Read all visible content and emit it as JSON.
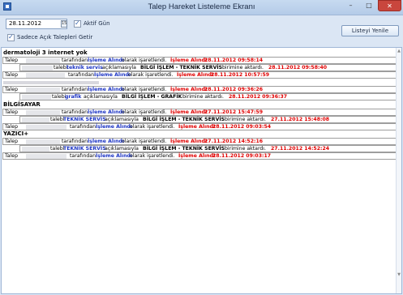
{
  "window": {
    "title": "Talep Hareket Listeleme Ekranı",
    "controls": {
      "minimize": "–",
      "maximize": "□",
      "close": "✕"
    }
  },
  "toolbar": {
    "date_value": "28.11.2012",
    "calendar_icon": "15",
    "aktif_gun_label": "Aktif Gün",
    "aktif_gun_checked": true,
    "sadece_acik_label": "Sadece Açık Talepleri Getir",
    "sadece_acik_checked": true,
    "refresh_label": "Listeyi Yenile"
  },
  "colors": {
    "blue": "#1d35c4",
    "red": "#e00000",
    "title_bg": "#c7daf0"
  },
  "groups": [
    {
      "title": "dermatoloji 3 internet yok",
      "rows": [
        {
          "type": "status",
          "talep": "Talep",
          "by": "tarafından",
          "status": "İşleme Alındı",
          "mid": "olarak işaretlendi.",
          "status2": "İşleme Alındı",
          "datetime": "28.11.2012 09:58:14"
        },
        {
          "type": "transfer",
          "prefix": "talebi",
          "unit": "teknik servis",
          "mid": "açıklamasıyla",
          "dept": "BİLGİ İŞLEM - TEKNİK SERVİS",
          "end": "birimine aktardı.",
          "datetime": "28.11.2012 09:58:40"
        },
        {
          "type": "status",
          "talep": "Talep",
          "by": "tarafından",
          "status": "İşleme Alındı",
          "mid": "olarak işaretlendi.",
          "status2": "İşleme Alındı",
          "datetime": "28.11.2012 10:57:59"
        }
      ]
    },
    {
      "title": "",
      "rows": [
        {
          "type": "status",
          "talep": "Talep",
          "by": "tarafından",
          "status": "İşleme Alındı",
          "mid": "olarak işaretlendi.",
          "status2": "İşleme Alındı",
          "datetime": "28.11.2012 09:36:26"
        },
        {
          "type": "transfer",
          "prefix": "talebi",
          "unit": "grafik",
          "mid": "açıklamasıyla",
          "dept": "BİLGİ İŞLEM - GRAFİK",
          "end": "birimine aktardı.",
          "datetime": "28.11.2012 09:36:37"
        }
      ]
    },
    {
      "title": "BİLGİSAYAR",
      "rows": [
        {
          "type": "status",
          "talep": "Talep",
          "by": "tarafından",
          "status": "İşleme Alındı",
          "mid": "olarak işaretlendi.",
          "status2": "İşleme Alındı",
          "datetime": "27.11.2012 15:47:59"
        },
        {
          "type": "transfer",
          "prefix": "talebi",
          "unit": "TEKNİK SERVİS",
          "mid": "açıklamasıyla",
          "dept": "BİLGİ İŞLEM - TEKNİK SERVİS",
          "end": "birimine aktardı.",
          "datetime": "27.11.2012 15:48:08"
        },
        {
          "type": "status",
          "talep": "Talep",
          "by": "tarafından",
          "status": "İşleme Alındı",
          "mid": "olarak işaretlendi.",
          "status2": "İşleme Alındı",
          "datetime": "28.11.2012 09:03:54"
        }
      ]
    },
    {
      "title": "YAZICI+",
      "rows": [
        {
          "type": "status",
          "talep": "Talep",
          "by": "tarafından",
          "status": "İşleme Alındı",
          "mid": "olarak işaretlendi.",
          "status2": "İşleme Alındı",
          "datetime": "27.11.2012 14:52:16"
        },
        {
          "type": "transfer",
          "prefix": "talebi",
          "unit": "TEKNİK SERVİS",
          "mid": "açıklamasıyla",
          "dept": "BİLGİ İŞLEM - TEKNİK SERVİS",
          "end": "birimine aktardı.",
          "datetime": "27.11.2012 14:52:24"
        },
        {
          "type": "status",
          "talep": "Talep",
          "by": "tarafından",
          "status": "İşleme Alındı",
          "mid": "olarak işaretlendi.",
          "status2": "İşleme Alındı",
          "datetime": "28.11.2012 09:03:17"
        }
      ]
    }
  ]
}
